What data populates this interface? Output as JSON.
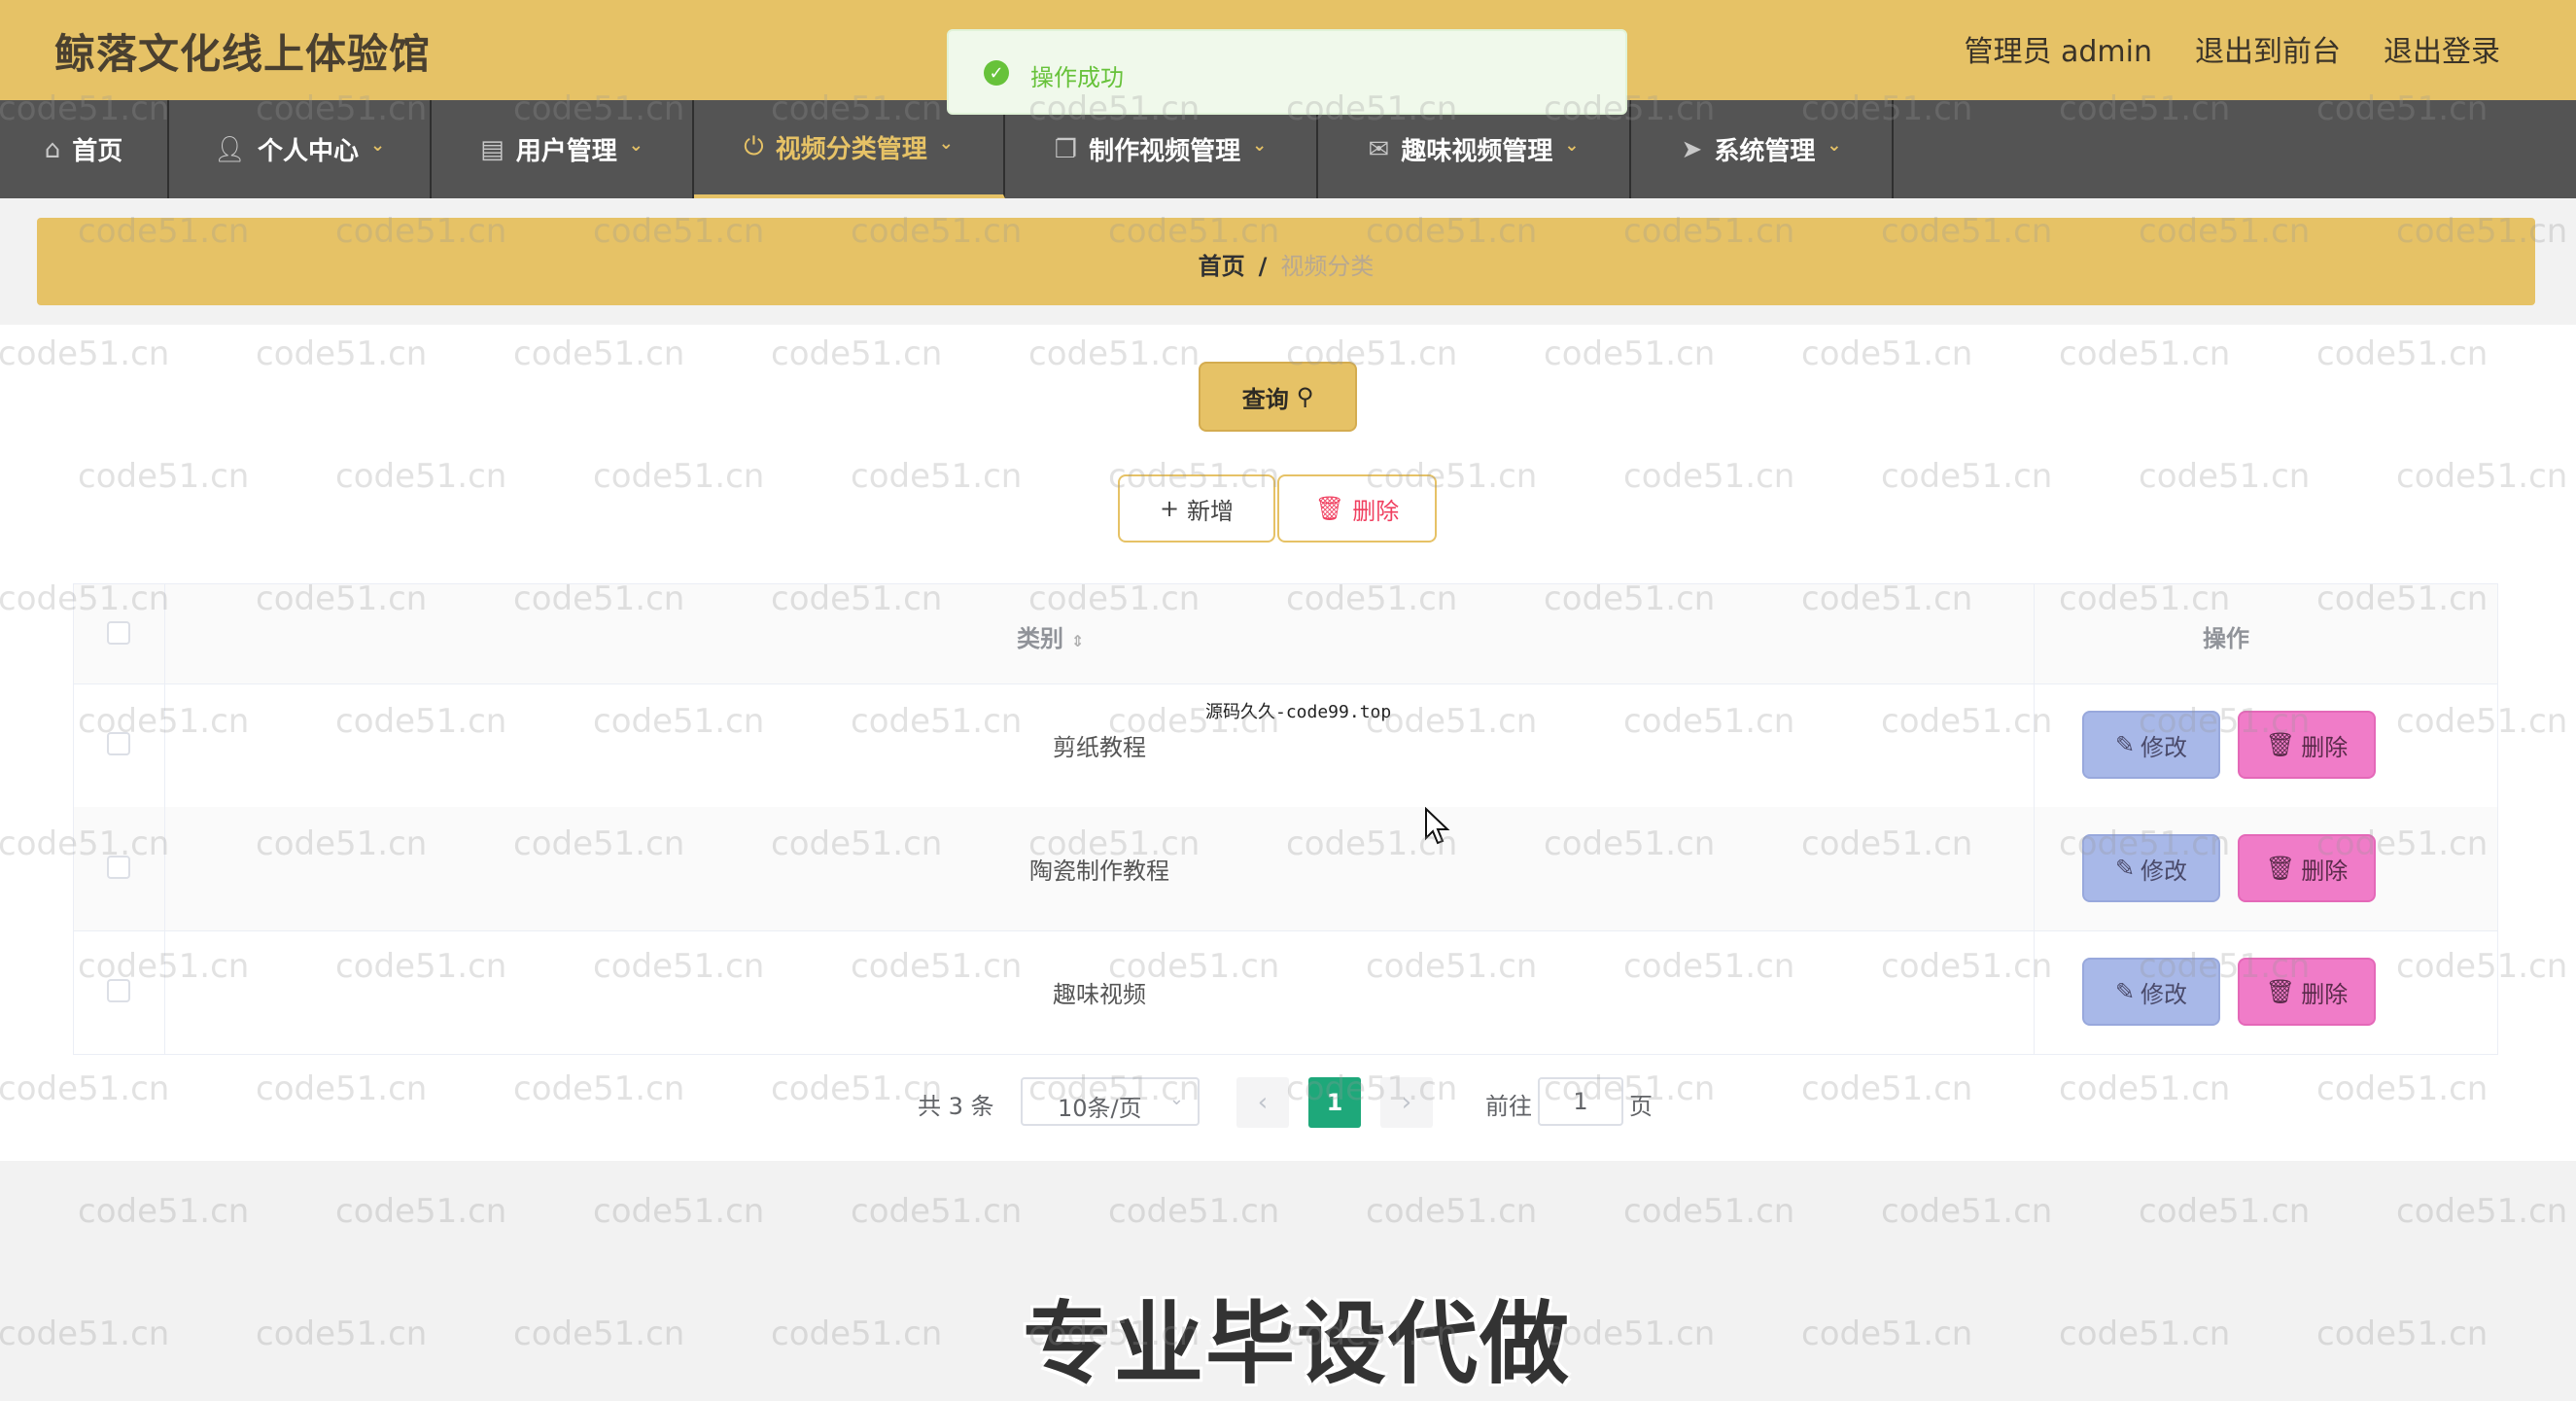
{
  "header": {
    "site_title": "鲸落文化线上体验馆",
    "admin_label": "管理员 admin",
    "to_frontend": "退出到前台",
    "logout": "退出登录"
  },
  "nav": {
    "items": [
      {
        "label": "首页",
        "icon": "home-icon"
      },
      {
        "label": "个人中心",
        "icon": "user-icon"
      },
      {
        "label": "用户管理",
        "icon": "id-card-icon"
      },
      {
        "label": "视频分类管理",
        "icon": "power-icon",
        "active": true
      },
      {
        "label": "制作视频管理",
        "icon": "copy-icon"
      },
      {
        "label": "趣味视频管理",
        "icon": "mail-icon"
      },
      {
        "label": "系统管理",
        "icon": "send-icon"
      }
    ]
  },
  "breadcrumb": {
    "home": "首页",
    "separator": "/",
    "current": "视频分类"
  },
  "toolbar": {
    "query_label": "查询",
    "add_label": "新增",
    "delete_label": "删除"
  },
  "table": {
    "columns": {
      "category": "类别",
      "actions": "操作"
    },
    "rows": [
      {
        "category": "剪纸教程"
      },
      {
        "category": "陶瓷制作教程"
      },
      {
        "category": "趣味视频"
      }
    ],
    "edit_label": "修改",
    "delete_label": "删除"
  },
  "pagination": {
    "total": "共 3 条",
    "page_size": "10条/页",
    "current_page": "1",
    "goto_label": "前往",
    "goto_value": "1",
    "page_suffix": "页"
  },
  "toast": {
    "message": "操作成功",
    "type": "success"
  },
  "credit": "源码久久-code99.top",
  "banner": "专业毕设代做",
  "watermark": "code51.cn",
  "colors": {
    "header_bg": "#e6c266",
    "nav_bg": "#545454",
    "edit_button": "#a8b8e8",
    "delete_button": "#f07cc8",
    "pagination_active": "#1ea87a",
    "toast_success": "#67c23a"
  }
}
